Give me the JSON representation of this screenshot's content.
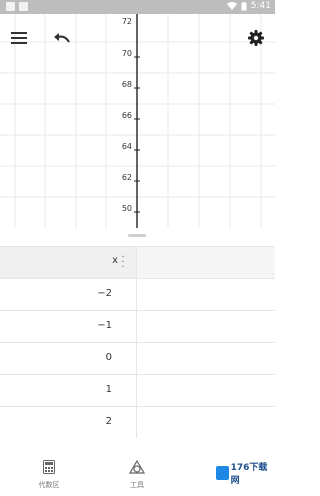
{
  "status_bar": {
    "time": "5:41"
  },
  "graph": {
    "y_ticks": [
      "72",
      "70",
      "68",
      "66",
      "64",
      "62",
      "50"
    ]
  },
  "toolbar": {
    "menu_icon": "menu-icon",
    "undo_icon": "undo-icon",
    "settings_icon": "gear-icon"
  },
  "table": {
    "column_header": "x",
    "values": [
      "−2",
      "−1",
      "0",
      "1",
      "2"
    ]
  },
  "bottom_nav": {
    "items": [
      {
        "icon": "calculator-icon",
        "label": "代数区"
      },
      {
        "icon": "geometry-tools-icon",
        "label": "工具"
      }
    ]
  },
  "watermark": {
    "text": "176下载网"
  },
  "colors": {
    "status_bar": "#bdbdbd",
    "grid_line": "#e9e9e9",
    "axis": "#222222",
    "accent": "#1e88e5"
  }
}
